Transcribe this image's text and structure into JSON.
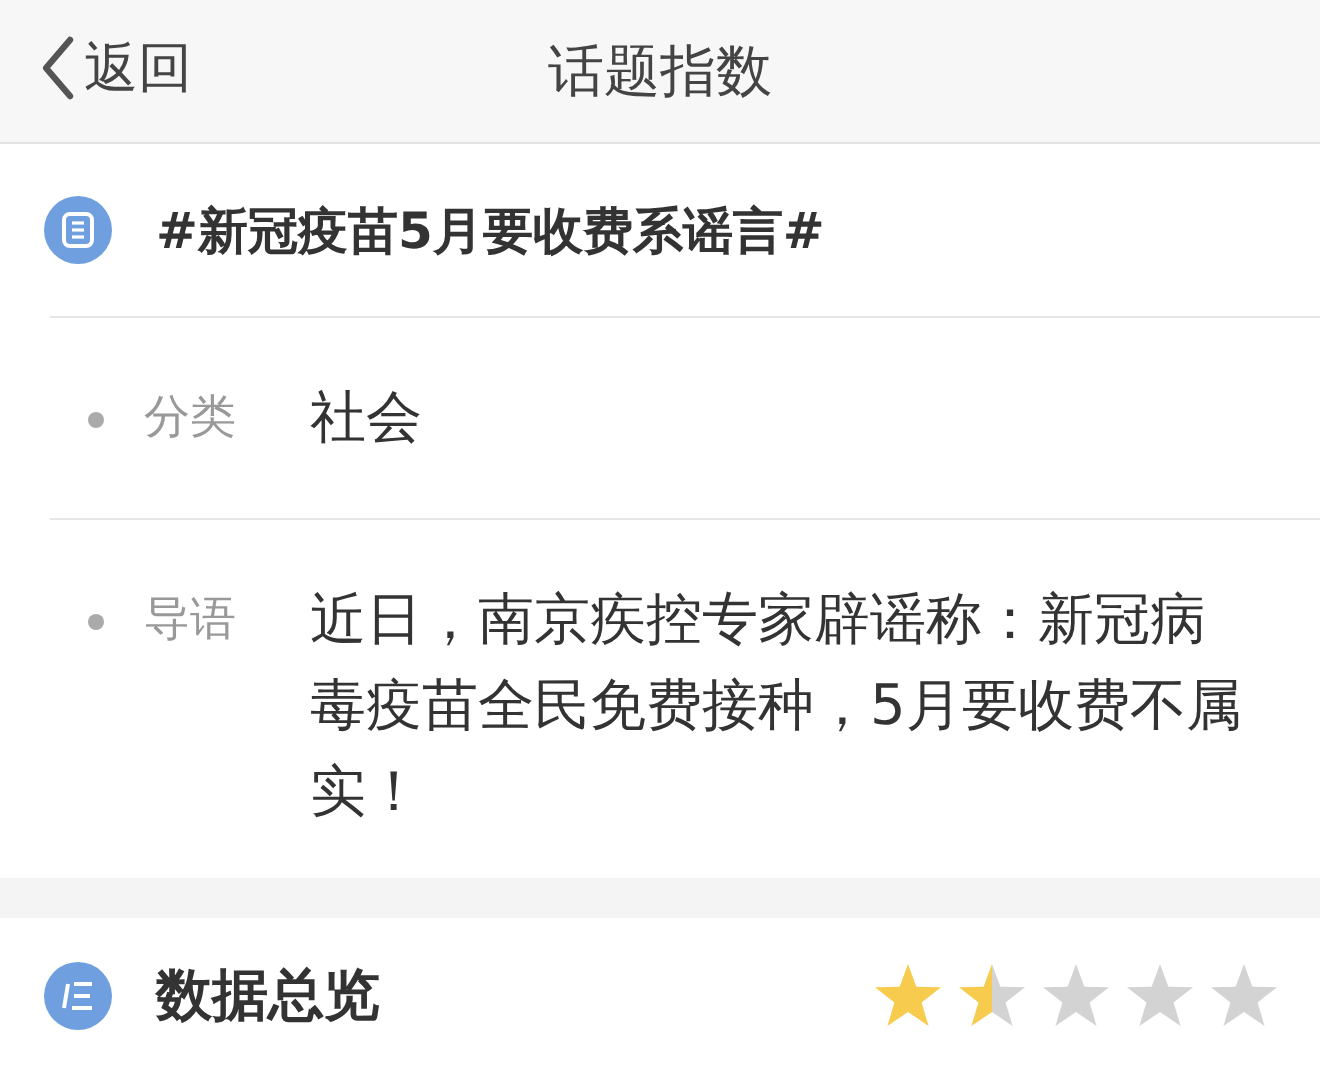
{
  "header": {
    "back_label": "返回",
    "title": "话题指数"
  },
  "topic": {
    "title": "#新冠疫苗5月要收费系谣言#"
  },
  "details": [
    {
      "label": "分类",
      "value": "社会"
    },
    {
      "label": "导语",
      "value": "近日，南京疾控专家辟谣称：新冠病毒疫苗全民免费接种，5月要收费不属实！"
    }
  ],
  "overview": {
    "title": "数据总览",
    "stars": 1.5
  }
}
